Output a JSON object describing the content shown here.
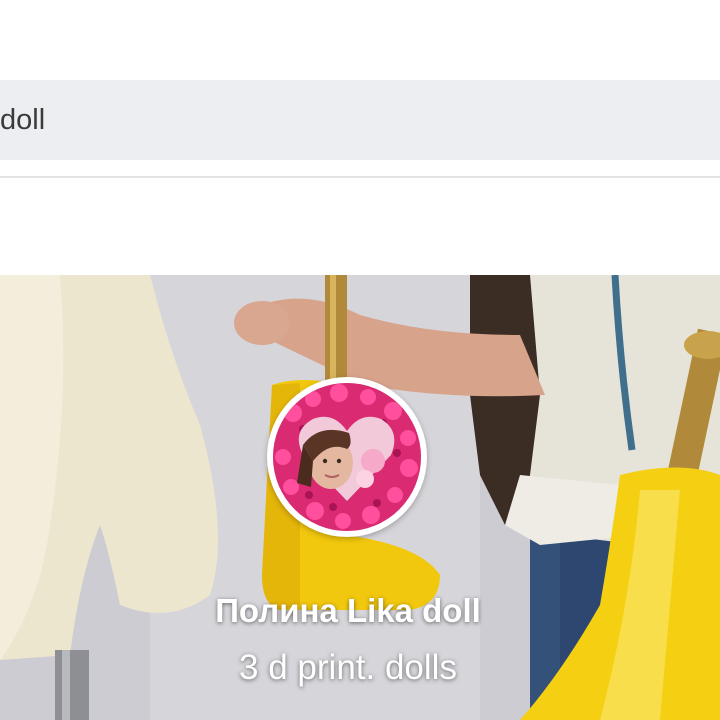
{
  "search": {
    "value": "doll"
  },
  "profile": {
    "name": "Полина Lika doll",
    "bio": "3 d print. dolls"
  },
  "icons": {
    "avatar": "avatar-photo",
    "cover": "cover-photo"
  },
  "colors": {
    "search_background": "#eceef1",
    "divider": "#e3e3e3",
    "text_overlay": "#ffffff"
  }
}
